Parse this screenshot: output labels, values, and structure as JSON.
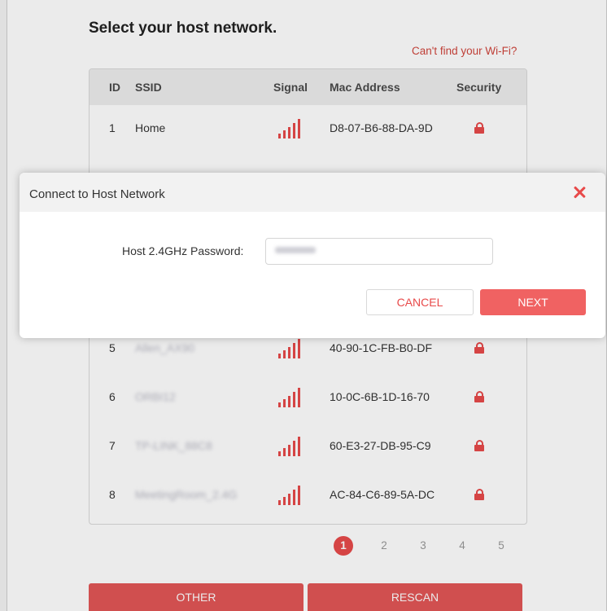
{
  "page": {
    "title": "Select your host network.",
    "cant_find_link": "Can't find your Wi-Fi?"
  },
  "table": {
    "columns": [
      "ID",
      "SSID",
      "Signal",
      "Mac Address",
      "Security"
    ],
    "rows": [
      {
        "id": "1",
        "ssid": "Home",
        "mac": "D8-07-B6-88-DA-9D",
        "signal": 5,
        "secured": true
      },
      {
        "id": "5",
        "ssid": "Allen_AX90",
        "mac": "40-90-1C-FB-B0-DF",
        "signal": 5,
        "secured": true
      },
      {
        "id": "6",
        "ssid": "ORBI12",
        "mac": "10-0C-6B-1D-16-70",
        "signal": 5,
        "secured": true
      },
      {
        "id": "7",
        "ssid": "TP-LINK_88C8",
        "mac": "60-E3-27-DB-95-C9",
        "signal": 5,
        "secured": true
      },
      {
        "id": "8",
        "ssid": "MeetingRoom_2.4G",
        "mac": "AC-84-C6-89-5A-DC",
        "signal": 5,
        "secured": true
      }
    ]
  },
  "pagination": {
    "pages": [
      "1",
      "2",
      "3",
      "4",
      "5"
    ],
    "current": "1"
  },
  "buttons": {
    "other": "OTHER",
    "rescan": "RESCAN"
  },
  "modal": {
    "title": "Connect to Host Network",
    "password_label": "Host 2.4GHz Password:",
    "password_value": "••••••••",
    "cancel": "CANCEL",
    "next": "NEXT"
  },
  "colors": {
    "accent": "#e84a4a",
    "header_bg": "#ededed"
  },
  "icons": {
    "signal": "signal-bars-icon",
    "lock": "lock-icon",
    "close": "close-icon"
  }
}
